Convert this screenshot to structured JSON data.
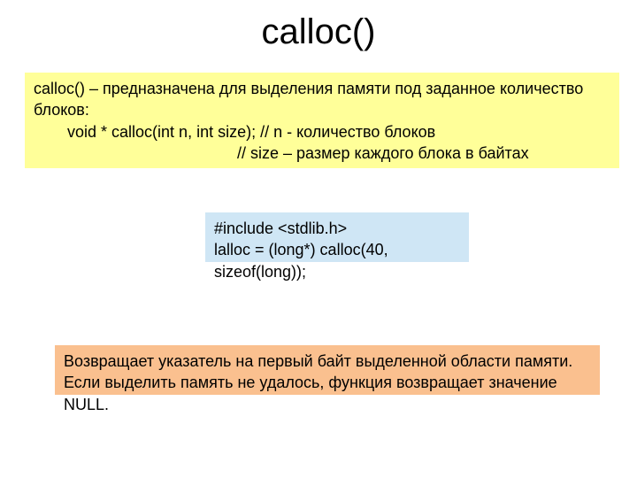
{
  "title": "calloc()",
  "yellow": {
    "line1": "calloc() – предназначена для выделения памяти под заданное количество блоков:",
    "line2": "void * calloc(int n, int size); // n - количество блоков",
    "line3": "// size – размер каждого блока в байтах"
  },
  "blue": {
    "line1": "#include <stdlib.h>",
    "line2": "lalloc = (long*) calloc(40, sizeof(long));"
  },
  "orange": {
    "line1": " Возвращает указатель на первый байт выделенной области памяти.",
    "line2": "Если выделить память не удалось, функция возвращает значение NULL."
  }
}
